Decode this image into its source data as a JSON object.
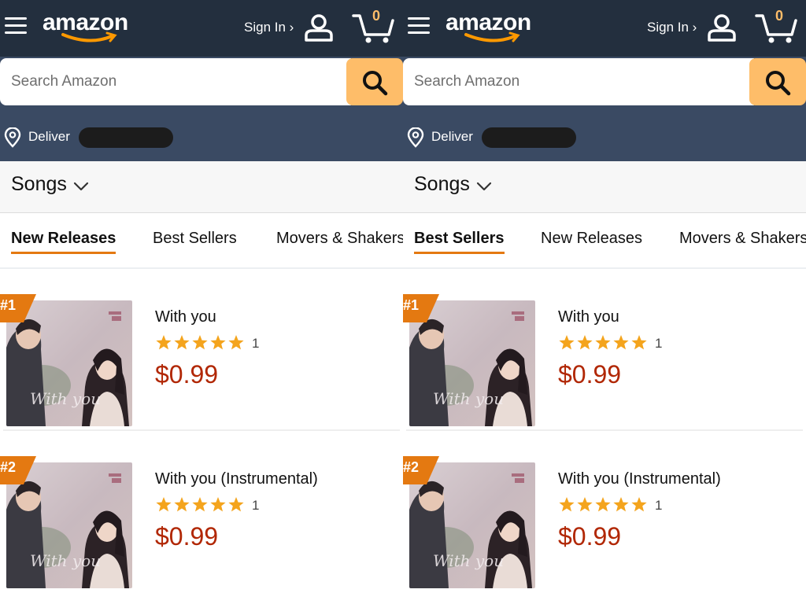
{
  "panels": [
    {
      "header": {
        "logo": "amazon",
        "sign_in": "Sign In ›",
        "cart_count": "0"
      },
      "search": {
        "placeholder": "Search Amazon"
      },
      "deliver_label": "Deliver",
      "category": "Songs",
      "tabs": [
        "New Releases",
        "Best Sellers",
        "Movers & Shakers"
      ],
      "active_tab": "New Releases",
      "items": [
        {
          "rank": "#1",
          "title": "With you",
          "rating": 5,
          "rating_count": "1",
          "price": "$0.99"
        },
        {
          "rank": "#2",
          "title": "With you (Instrumental)",
          "rating": 5,
          "rating_count": "1",
          "price": "$0.99"
        }
      ]
    },
    {
      "header": {
        "logo": "amazon",
        "sign_in": "Sign In ›",
        "cart_count": "0"
      },
      "search": {
        "placeholder": "Search Amazon"
      },
      "deliver_label": "Deliver",
      "category": "Songs",
      "tabs": [
        "Best Sellers",
        "New Releases",
        "Movers & Shakers"
      ],
      "active_tab": "Best Sellers",
      "items": [
        {
          "rank": "#1",
          "title": "With you",
          "rating": 5,
          "rating_count": "1",
          "price": "$0.99"
        },
        {
          "rank": "#2",
          "title": "With you (Instrumental)",
          "rating": 5,
          "rating_count": "1",
          "price": "$0.99"
        }
      ]
    }
  ],
  "colors": {
    "header_bg": "#232f3e",
    "deliver_bg": "#3a4a63",
    "accent": "#febd69",
    "price": "#b12704",
    "star": "#f4a41d",
    "tab_underline": "#e47911"
  },
  "icons": [
    "menu-icon",
    "user-icon",
    "cart-icon",
    "search-icon",
    "location-pin-icon",
    "chevron-down-icon",
    "star-icon"
  ]
}
